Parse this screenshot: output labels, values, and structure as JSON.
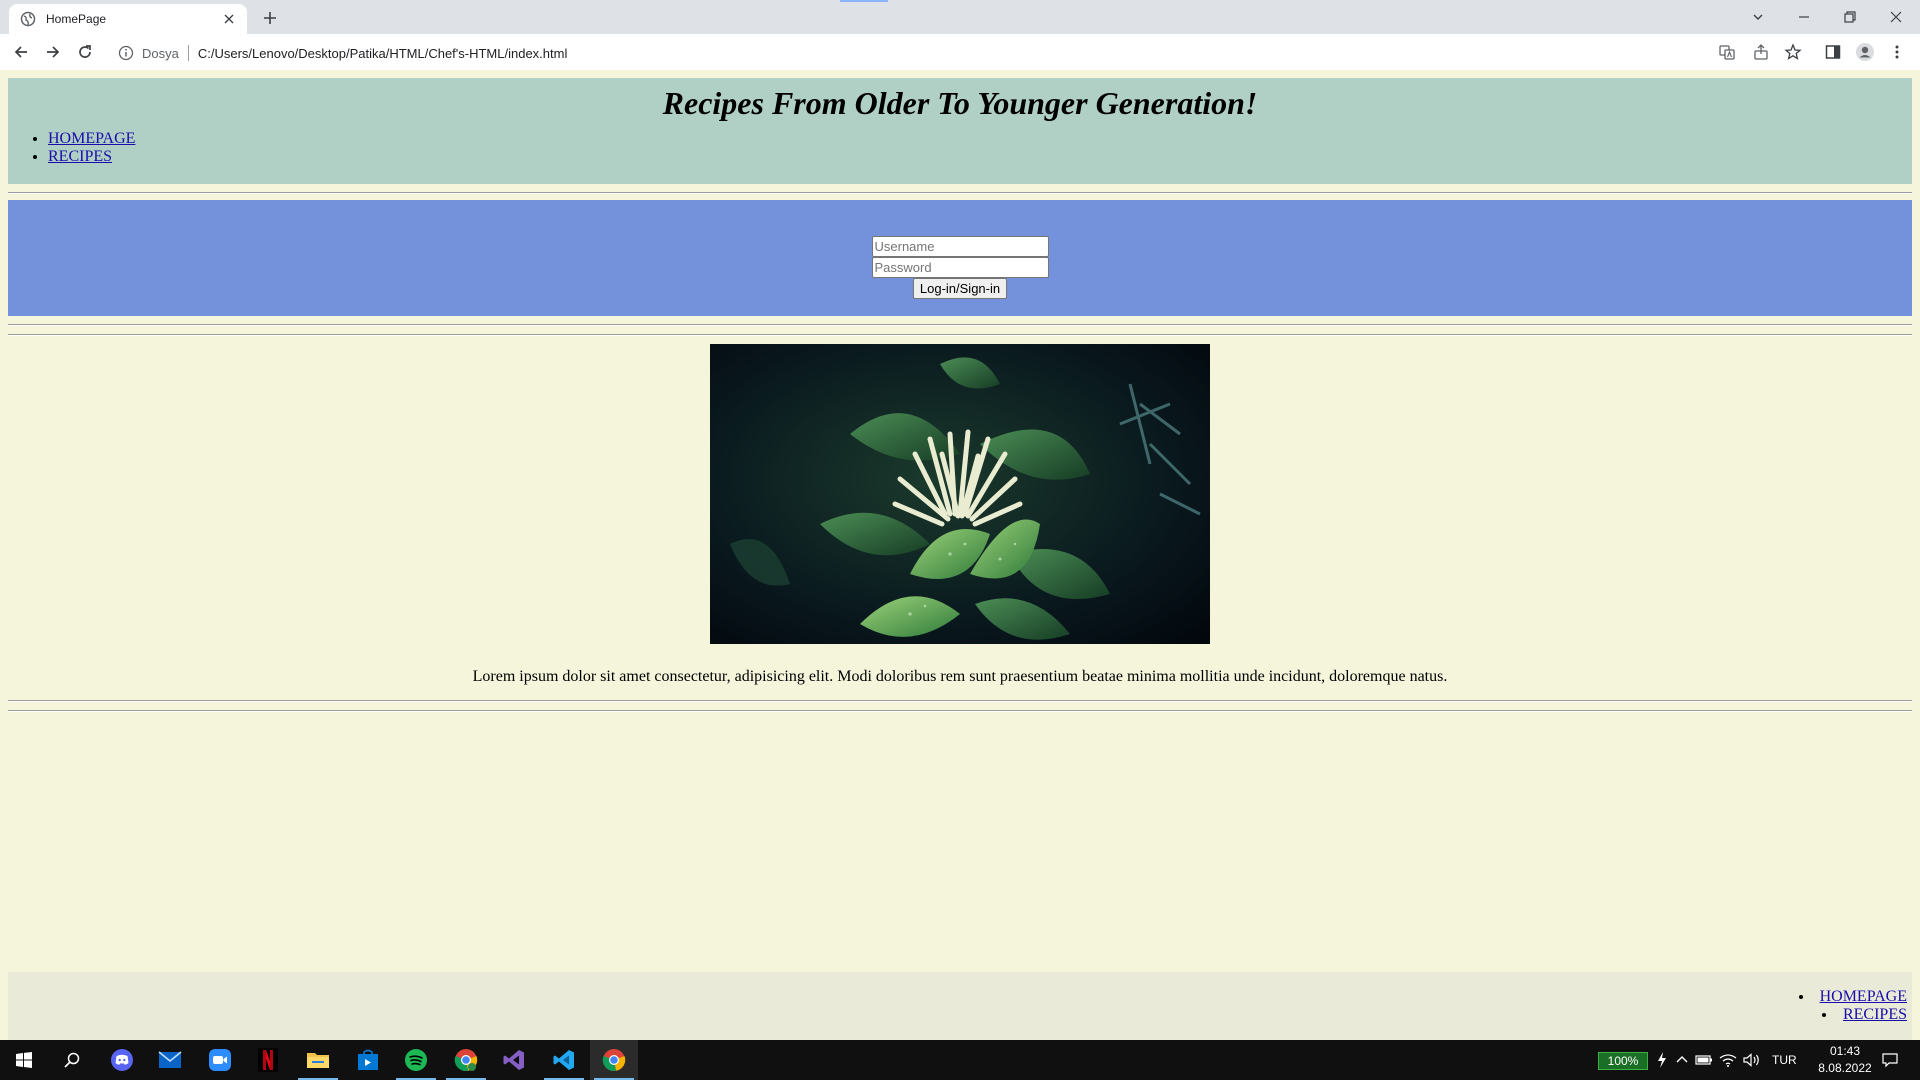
{
  "browser": {
    "tab_title": "HomePage",
    "scheme_label": "Dosya",
    "url": "C:/Users/Lenovo/Desktop/Patika/HTML/Chef's-HTML/index.html"
  },
  "page": {
    "title": "Recipes From Older To Younger Generation!",
    "nav": [
      "HOMEPAGE",
      "RECIPES"
    ],
    "login": {
      "username_placeholder": "Username",
      "password_placeholder": "Password",
      "button_label": "Log-in/Sign-in"
    },
    "paragraph": "Lorem ipsum dolor sit amet consectetur, adipisicing elit. Modi doloribus rem sunt praesentium beatae minima mollitia unde incidunt, doloremque natus.",
    "footer_nav": [
      "HOMEPAGE",
      "RECIPES"
    ],
    "colors": {
      "header_bg": "#b0d0c5",
      "login_bg": "#7392db",
      "page_bg": "#f5f5dc",
      "footer_bg": "#eaead8"
    }
  },
  "taskbar": {
    "apps": [
      "start-icon",
      "search-icon",
      "discord-icon",
      "mail-icon",
      "zoom-icon",
      "netflix-icon",
      "file-explorer-icon",
      "store-icon",
      "spotify-icon",
      "chrome-icon",
      "visual-studio-icon",
      "vscode-icon",
      "chrome-icon"
    ],
    "battery": "100%",
    "language": "TUR",
    "time": "01:43",
    "date": "8.08.2022"
  }
}
